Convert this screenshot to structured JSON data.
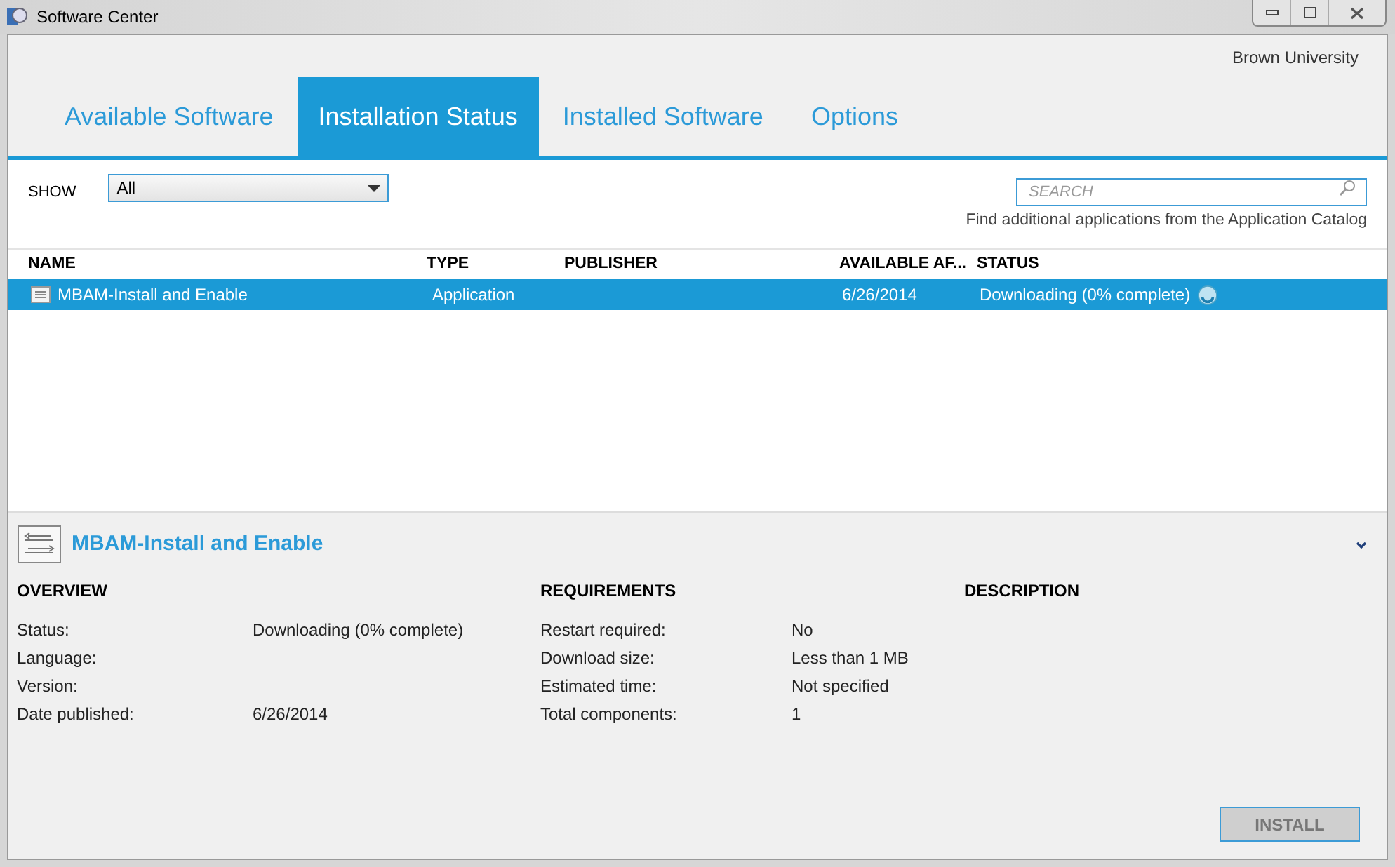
{
  "window": {
    "title": "Software Center"
  },
  "organization": "Brown University",
  "tabs": [
    {
      "label": "Available Software",
      "selected": false
    },
    {
      "label": "Installation Status",
      "selected": true
    },
    {
      "label": "Installed Software",
      "selected": false
    },
    {
      "label": "Options",
      "selected": false
    }
  ],
  "filter": {
    "label": "SHOW",
    "value": "All"
  },
  "search": {
    "placeholder": "SEARCH"
  },
  "catalog_link": "Find additional applications from the Application Catalog",
  "table": {
    "columns": [
      "NAME",
      "TYPE",
      "PUBLISHER",
      "AVAILABLE AF...",
      "STATUS"
    ],
    "rows": [
      {
        "selected": true,
        "cells": [
          "MBAM-Install and Enable",
          "Application",
          null,
          "6/26/2014",
          "Downloading (0% complete)"
        ]
      }
    ]
  },
  "details": {
    "title": "MBAM-Install and Enable",
    "overview": {
      "heading": "OVERVIEW",
      "fields": [
        {
          "label": "Status:",
          "value": "Downloading (0% complete)"
        },
        {
          "label": "Language:"
        },
        {
          "label": "Version:"
        },
        {
          "label": "Date published:",
          "value": "6/26/2014"
        }
      ]
    },
    "requirements": {
      "heading": "REQUIREMENTS",
      "fields": [
        {
          "label": "Restart required:",
          "value": "No"
        },
        {
          "label": "Download size:",
          "value": "Less than 1 MB"
        },
        {
          "label": "Estimated time:",
          "value": "Not specified"
        },
        {
          "label": "Total components:",
          "value": "1"
        }
      ]
    },
    "description": {
      "heading": "DESCRIPTION"
    },
    "install_button": {
      "label": "INSTALL",
      "disabled": true
    }
  }
}
